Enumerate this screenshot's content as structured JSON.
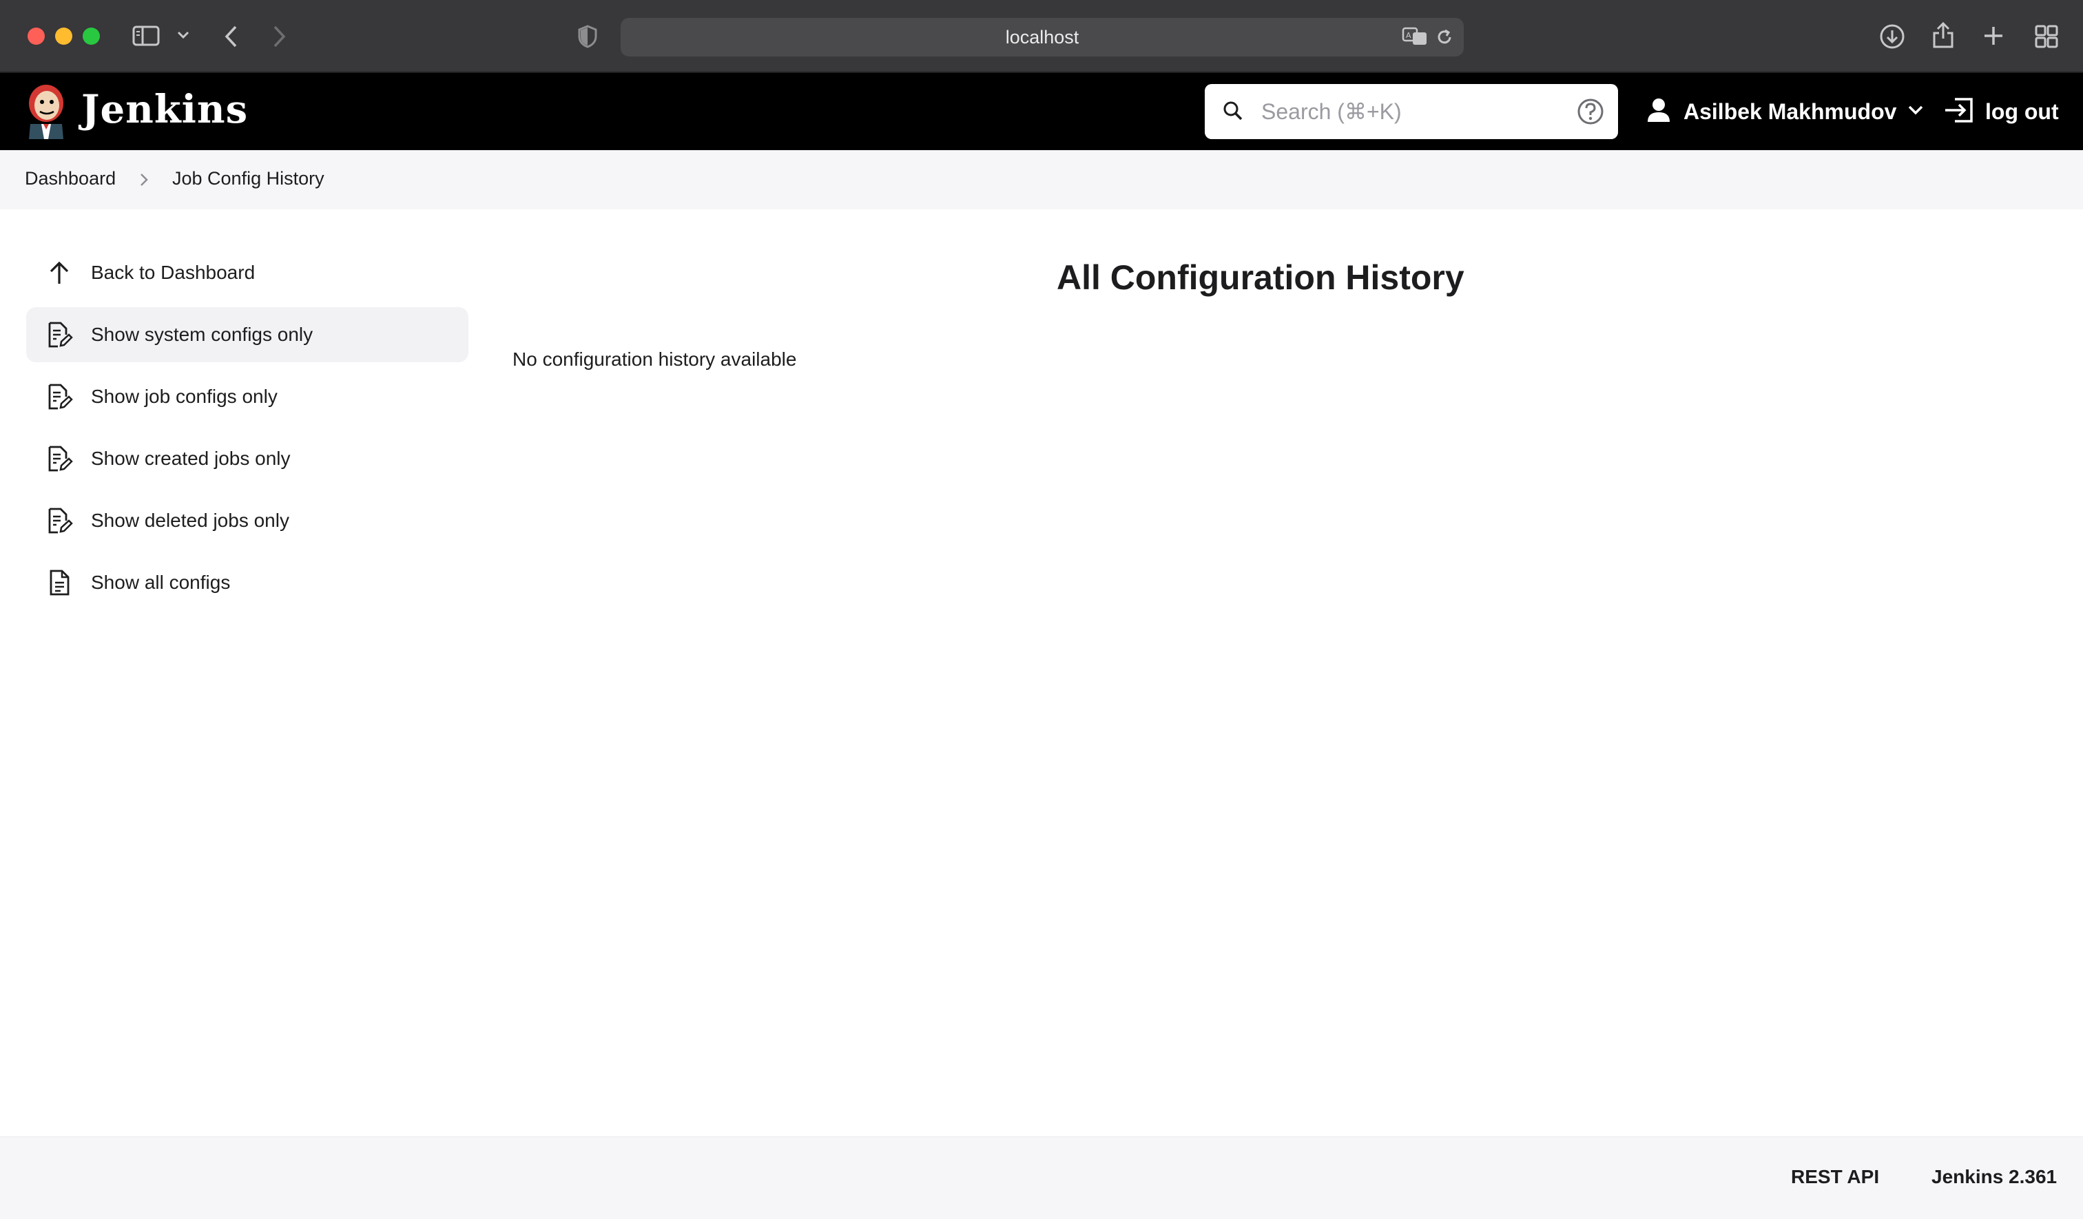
{
  "browser": {
    "url": "localhost"
  },
  "header": {
    "brand": "Jenkins",
    "search_placeholder": "Search (⌘+K)",
    "user_name": "Asilbek Makhmudov",
    "logout_label": "log out"
  },
  "breadcrumb": {
    "items": [
      "Dashboard",
      "Job Config History"
    ]
  },
  "sidebar": {
    "items": [
      {
        "label": "Back to Dashboard",
        "icon": "arrow-up-icon"
      },
      {
        "label": "Show system configs only",
        "icon": "config-document-icon",
        "active": true
      },
      {
        "label": "Show job configs only",
        "icon": "config-document-icon"
      },
      {
        "label": "Show created jobs only",
        "icon": "config-document-icon"
      },
      {
        "label": "Show deleted jobs only",
        "icon": "config-document-icon"
      },
      {
        "label": "Show all configs",
        "icon": "document-icon"
      }
    ]
  },
  "main": {
    "title": "All Configuration History",
    "empty_message": "No configuration history available"
  },
  "footer": {
    "rest_api": "REST API",
    "version": "Jenkins 2.361"
  }
}
